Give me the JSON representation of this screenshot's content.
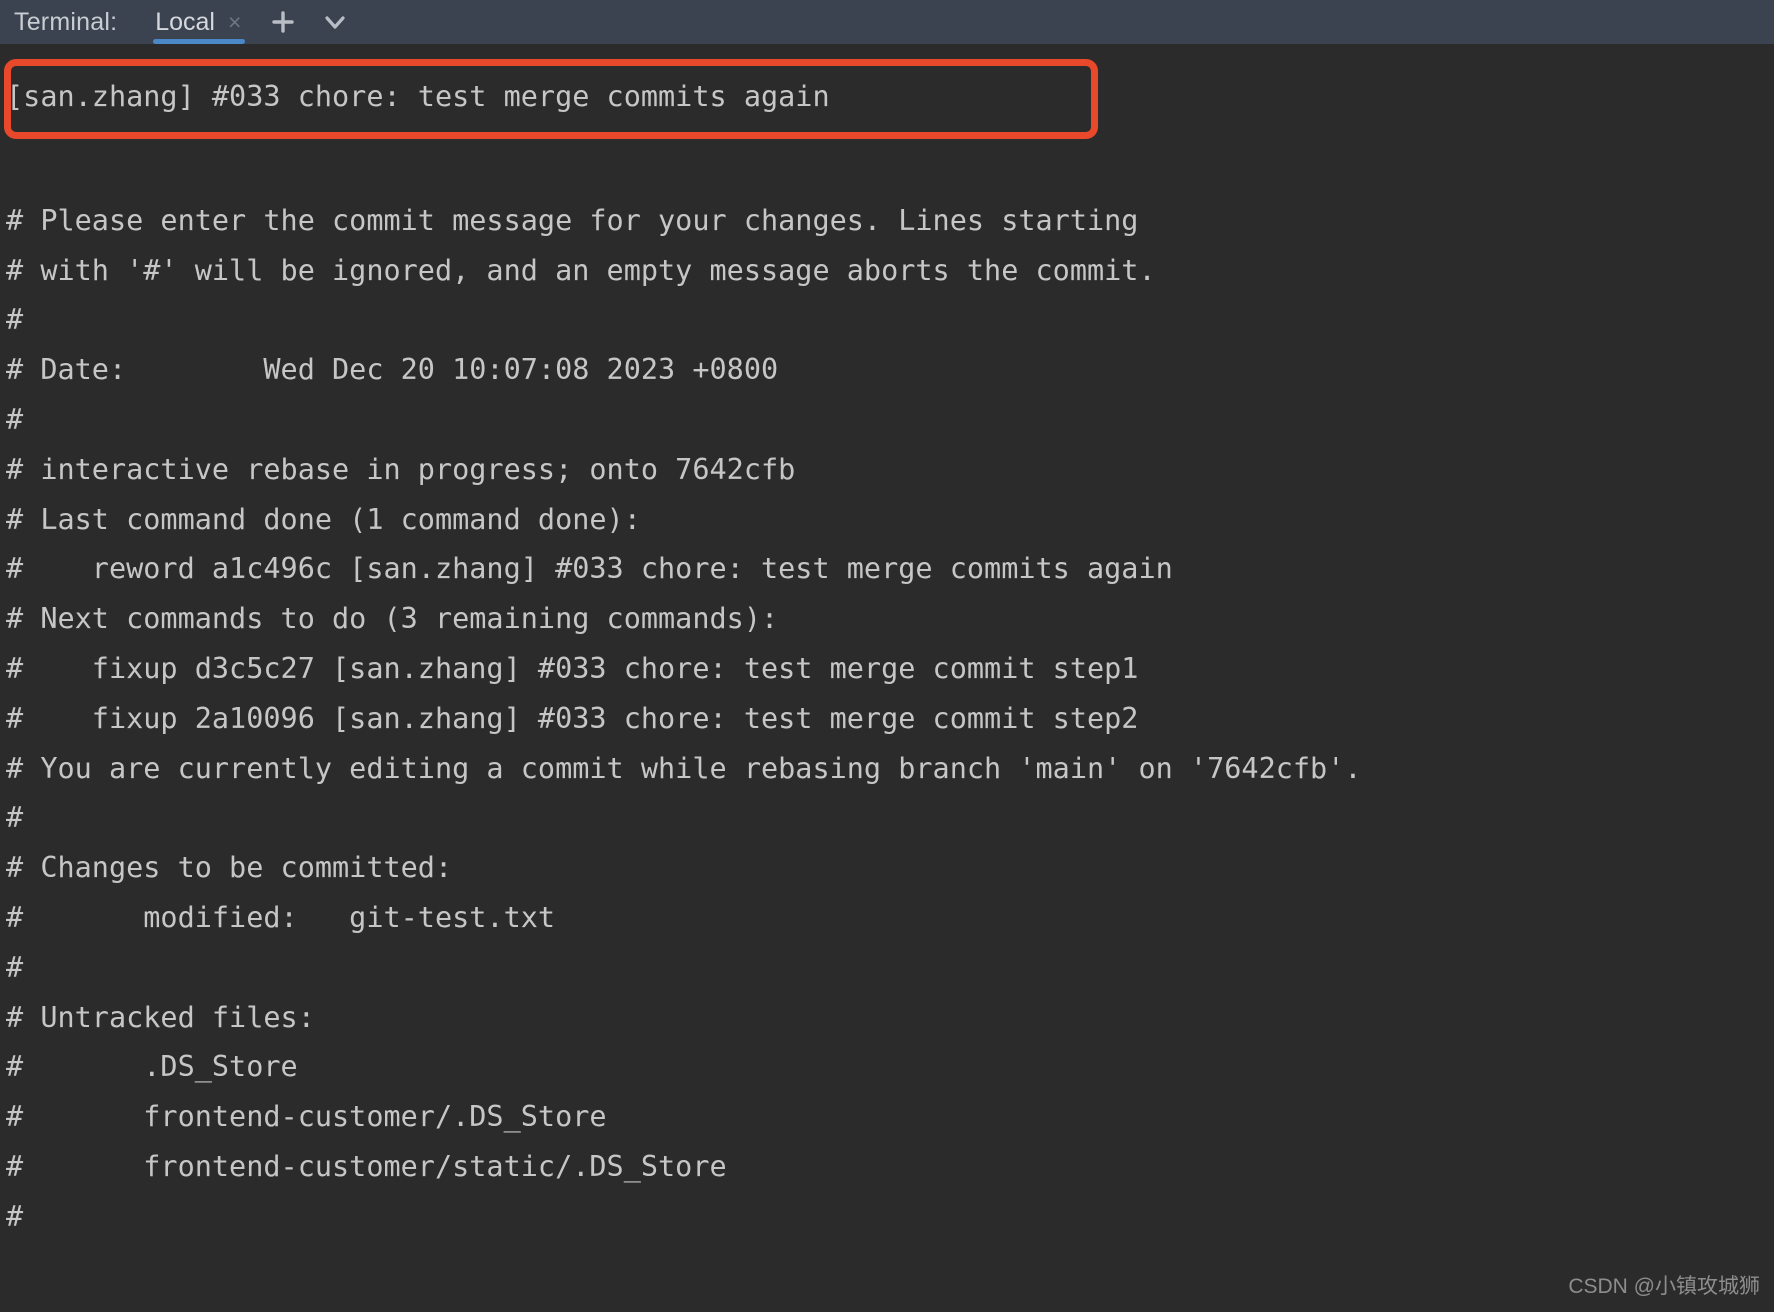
{
  "window": {
    "tool_label": "Terminal:",
    "tab": {
      "label": "Local",
      "close_glyph": "×"
    },
    "add_tab_title": "+",
    "options_title": "∨",
    "accent_tab_underline": "#4a88c7",
    "header_bg": "#3c4350",
    "terminal_bg": "#2b2b2b",
    "text_color": "#c6c6c6",
    "highlight_color": "#e8492b"
  },
  "terminal": {
    "highlighted_line": "[san.zhang] #033 chore: test merge commits again",
    "lines": [
      "",
      "# Please enter the commit message for your changes. Lines starting",
      "# with '#' will be ignored, and an empty message aborts the commit.",
      "#",
      "# Date:        Wed Dec 20 10:07:08 2023 +0800",
      "#",
      "# interactive rebase in progress; onto 7642cfb",
      "# Last command done (1 command done):",
      "#    reword a1c496c [san.zhang] #033 chore: test merge commits again",
      "# Next commands to do (3 remaining commands):",
      "#    fixup d3c5c27 [san.zhang] #033 chore: test merge commit step1",
      "#    fixup 2a10096 [san.zhang] #033 chore: test merge commit step2",
      "# You are currently editing a commit while rebasing branch 'main' on '7642cfb'.",
      "#",
      "# Changes to be committed:",
      "#       modified:   git-test.txt",
      "#",
      "# Untracked files:",
      "#       .DS_Store",
      "#       frontend-customer/.DS_Store",
      "#       frontend-customer/static/.DS_Store",
      "#"
    ]
  },
  "watermark": {
    "text": "CSDN @小镇攻城狮"
  }
}
